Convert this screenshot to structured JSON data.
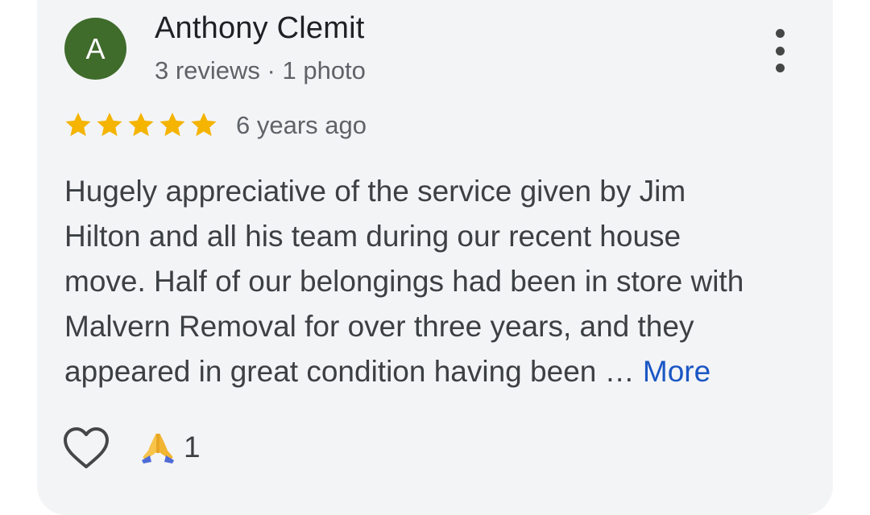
{
  "reviewer": {
    "avatar_letter": "A",
    "avatar_color": "#3f6b2b",
    "name": "Anthony Clemit",
    "meta": "3 reviews · 1 photo"
  },
  "rating": {
    "stars": 5,
    "star_color": "#f4b400",
    "time_ago": "6 years ago"
  },
  "review": {
    "lines": [
      "Hugely appreciative of the service given by Jim",
      "Hilton and all his team during our recent house",
      "move. Half of our belongings had been in store with",
      "Malvern Removal for over three years, and they",
      "appeared in great condition having been … "
    ],
    "more_label": "More",
    "link_color": "#1a56c4"
  },
  "actions": {
    "like_icon": "heart-outline-icon",
    "reaction_icon": "folded-hands-emoji",
    "reaction_count": "1",
    "menu_icon": "vertical-dots-icon"
  }
}
